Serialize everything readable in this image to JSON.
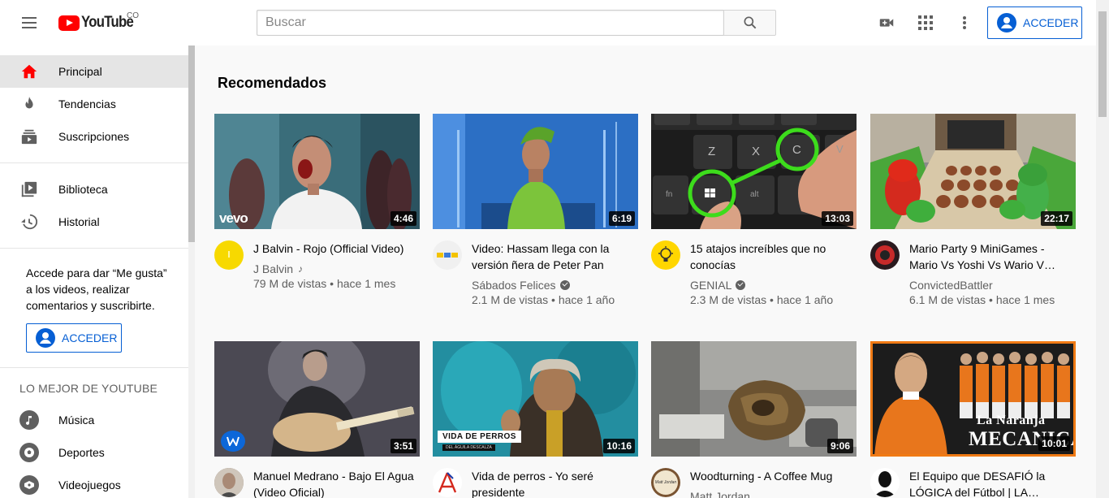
{
  "header": {
    "logo_text": "YouTube",
    "country_code": "CO",
    "search_placeholder": "Buscar",
    "signin_label": "ACCEDER",
    "icons": [
      "menu-icon",
      "search-icon",
      "video-camera-icon",
      "apps-grid-icon",
      "more-vert-icon",
      "account-icon"
    ]
  },
  "sidebar": {
    "primary": [
      {
        "label": "Principal",
        "icon": "home-icon",
        "active": true
      },
      {
        "label": "Tendencias",
        "icon": "flame-icon"
      },
      {
        "label": "Suscripciones",
        "icon": "subscriptions-icon"
      }
    ],
    "secondary": [
      {
        "label": "Biblioteca",
        "icon": "library-icon"
      },
      {
        "label": "Historial",
        "icon": "history-icon"
      }
    ],
    "signin_prompt": "Accede para dar “Me gusta” a los videos, realizar comentarios y suscribirte.",
    "signin_label": "ACCEDER",
    "best_of_title": "LO MEJOR DE YOUTUBE",
    "best_of": [
      {
        "label": "Música",
        "icon": "music-icon"
      },
      {
        "label": "Deportes",
        "icon": "sports-icon"
      },
      {
        "label": "Videojuegos",
        "icon": "gaming-icon"
      }
    ]
  },
  "main": {
    "heading": "Recomendados",
    "videos": [
      {
        "title": "J Balvin - Rojo (Official Video)",
        "channel": "J Balvin",
        "badge": "music",
        "stats": "79 M de vistas • hace 1 mes",
        "duration": "4:46"
      },
      {
        "title": "Video: Hassam llega con la versión ñera de Peter Pan",
        "channel": "Sábados Felices",
        "badge": "verified",
        "stats": "2.1 M de vistas • hace 1 año",
        "duration": "6:19"
      },
      {
        "title": "15 atajos increíbles que no conocías",
        "channel": "GENIAL",
        "badge": "verified",
        "stats": "2.3 M de vistas • hace 1 año",
        "duration": "13:03"
      },
      {
        "title": "Mario Party 9 MiniGames - Mario Vs Yoshi Vs Wario V…",
        "channel": "ConvictedBattler",
        "badge": "",
        "stats": "6.1 M de vistas • hace 1 mes",
        "duration": "22:17"
      },
      {
        "title": "Manuel Medrano - Bajo El Agua (Video Oficial)",
        "channel": "",
        "badge": "",
        "stats": "",
        "duration": "3:51"
      },
      {
        "title": "Vida de perros - Yo seré presidente",
        "channel": "",
        "badge": "",
        "stats": "",
        "duration": "10:16"
      },
      {
        "title": "Woodturning - A Coffee Mug",
        "channel": "Matt Jordan",
        "badge": "",
        "stats": "",
        "duration": "9:06"
      },
      {
        "title": "El Equipo que DESAFIÓ la LÓGICA del Fútbol | LA…",
        "channel": "",
        "badge": "",
        "stats": "",
        "duration": "10:01"
      }
    ],
    "thumb_texts": {
      "vevo": "vevo",
      "key_z": "Z",
      "key_x": "X",
      "key_c": "C",
      "key_fn": "fn",
      "key_alt": "alt",
      "key_v": "V",
      "vida_de_perros": "VIDA DE PERROS",
      "vida_sub": "DEL ÁGUILA DESCALZA",
      "naranja_1": "La Naranja",
      "naranja_2": "MECANICA",
      "matt_avatar": "Matt Jordan"
    }
  },
  "colors": {
    "accent": "#065fd4",
    "brand": "#ff0000",
    "active_bg": "#e5e5e5"
  }
}
